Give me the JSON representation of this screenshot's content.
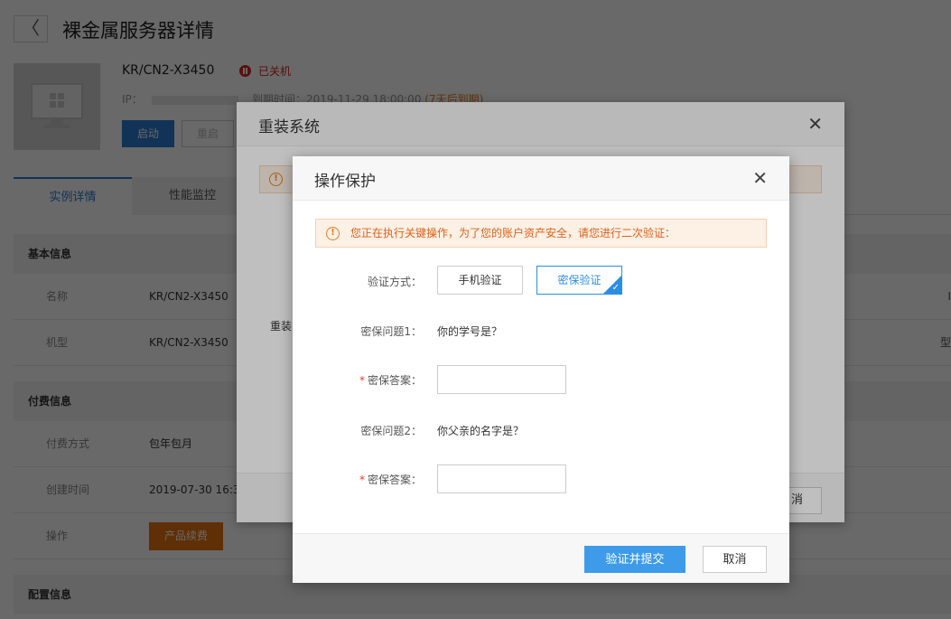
{
  "header": {
    "back_glyph": "〈",
    "title": "裸金属服务器详情"
  },
  "server": {
    "name": "KR/CN2-X3450",
    "status": "已关机",
    "ip_label": "IP：",
    "expire_label": "到期时间：2019-11-29 18:00:00 ",
    "expire_warning": "(7天后到期)",
    "buttons": {
      "start": "启动",
      "restart": "重启"
    }
  },
  "tabs": [
    "实例详情",
    "性能监控"
  ],
  "sections": {
    "basic": "基本信息",
    "billing": "付费信息",
    "config": "配置信息"
  },
  "basic_rows": [
    {
      "label": "名称",
      "value": "KR/CN2-X3450",
      "edge": "I"
    },
    {
      "label": "机型",
      "value": "KR/CN2-X3450",
      "edge": "型"
    }
  ],
  "billing_rows": [
    {
      "label": "付费方式",
      "value": "包年包月"
    },
    {
      "label": "创建时间",
      "value": "2019-07-30 16:3"
    },
    {
      "label": "操作",
      "button": "产品续费"
    }
  ],
  "reinstall_modal": {
    "title": "重装系统",
    "close": "✕",
    "alert_icon": "!",
    "label": "重装",
    "cancel": "消"
  },
  "protect_modal": {
    "title": "操作保护",
    "close": "✕",
    "alert_icon": "!",
    "alert": "您正在执行关键操作，为了您的账户资产安全，请您进行二次验证：",
    "method_label": "验证方式：",
    "methods": [
      "手机验证",
      "密保验证"
    ],
    "selected_method": "密保验证",
    "check_glyph": "✓",
    "q1_label": "密保问题1：",
    "q1": "你的学号是？",
    "a1_label": "密保答案：",
    "a1_value": "",
    "q2_label": "密保问题2：",
    "q2": "你父亲的名字是？",
    "a2_label": "密保答案：",
    "a2_value": "",
    "required_mark": "*",
    "submit": "验证并提交",
    "cancel": "取消"
  },
  "colors": {
    "primary": "#2b7dd6",
    "selected": "#2b8ee4",
    "submit": "#3d9bea",
    "warning": "#e8740d",
    "danger": "#d9261c"
  }
}
